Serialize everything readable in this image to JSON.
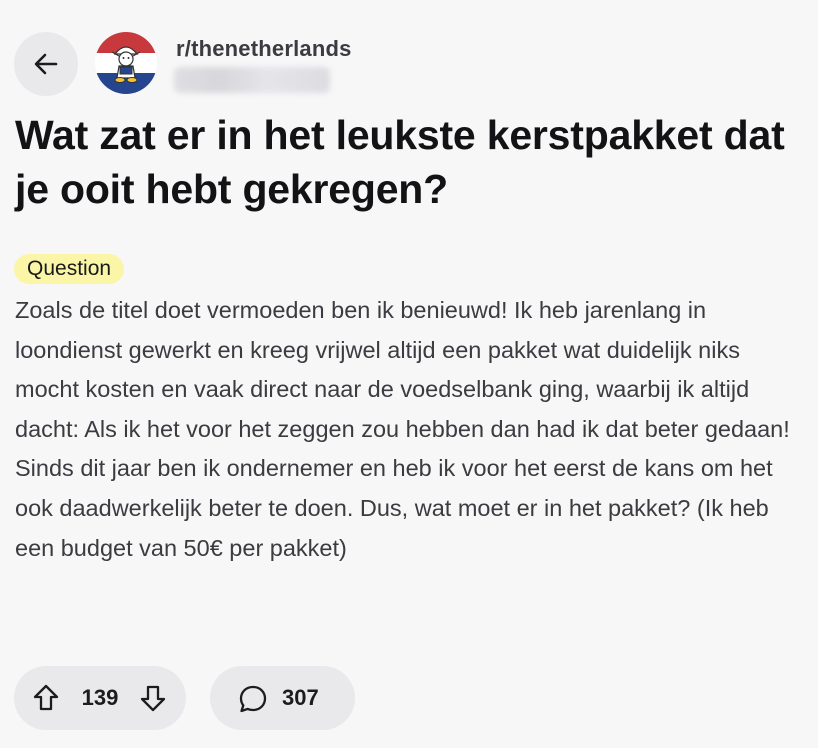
{
  "header": {
    "back_icon": "arrow-left-icon",
    "avatar_icon": "subreddit-avatar-dutch-flag",
    "subreddit": "r/thenetherlands"
  },
  "post": {
    "title": "Wat zat er in het leukste kerstpakket dat je ooit hebt gekregen?",
    "flair": "Question",
    "body": "Zoals de titel doet vermoeden ben ik benieuwd! Ik heb jarenlang in loondienst gewerkt en kreeg vrijwel altijd een pakket wat duidelijk niks mocht kosten en vaak direct naar de voedselbank ging, waarbij ik altijd dacht: Als ik het voor het zeggen zou hebben dan had ik dat beter gedaan! Sinds dit jaar ben ik ondernemer en heb ik voor het eerst de kans om het ook daadwerkelijk beter te doen. Dus, wat moet er in het pakket? (Ik heb een budget van 50€ per pakket)"
  },
  "actions": {
    "upvote_icon": "arrow-up-icon",
    "downvote_icon": "arrow-down-icon",
    "vote_count": "139",
    "comment_icon": "speech-bubble-icon",
    "comment_count": "307"
  },
  "colors": {
    "background": "#f7f7f8",
    "pill": "#e9e9ec",
    "flair": "#fbf6a7",
    "flag_red": "#c8393e",
    "flag_white": "#ffffff",
    "flag_blue": "#25468f"
  }
}
